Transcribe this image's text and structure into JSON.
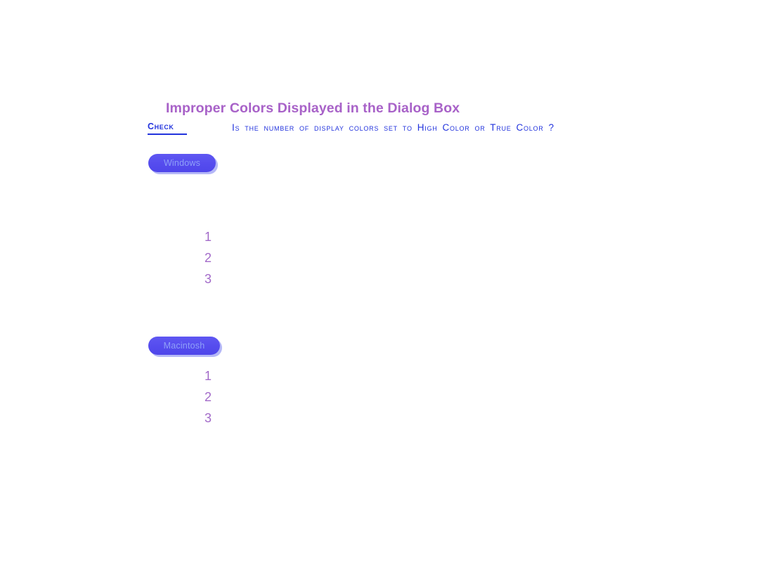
{
  "document": {
    "section_title": "Improper Colors Displayed in the Dialog Box",
    "colors": {
      "heading_purple": "#A862C8",
      "check_blue": "#2233DD",
      "pill_fill": "#554cee",
      "pill_text": "#8fa0f8",
      "step_number_purple": "#A36BC9"
    }
  },
  "check": {
    "label": "Check",
    "question": "Is the number of display colors set to High Color or True Color ?"
  },
  "platforms": [
    {
      "id": "windows",
      "badge": "Windows",
      "steps": [
        {
          "number": "1",
          "text": ""
        },
        {
          "number": "2",
          "text": ""
        },
        {
          "number": "3",
          "text": ""
        }
      ]
    },
    {
      "id": "macintosh",
      "badge": "Macintosh",
      "steps": [
        {
          "number": "1",
          "text": ""
        },
        {
          "number": "2",
          "text": ""
        },
        {
          "number": "3",
          "text": ""
        }
      ]
    }
  ]
}
